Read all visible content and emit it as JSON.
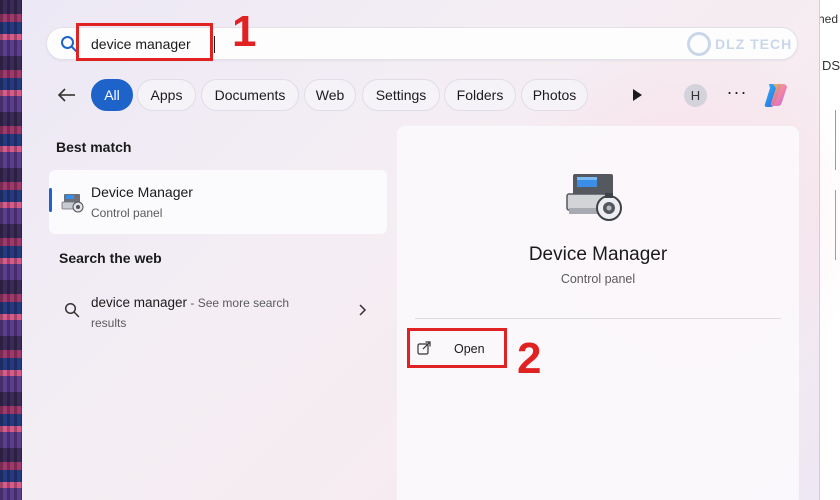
{
  "search": {
    "query": "device manager"
  },
  "watermark": {
    "text": "DLZ TECH"
  },
  "annotations": {
    "step1": "1",
    "step2": "2"
  },
  "filters": {
    "chips": [
      "All",
      "Apps",
      "Documents",
      "Web",
      "Settings",
      "Folders",
      "Photos"
    ],
    "active": "All",
    "avatar_initial": "H",
    "more_label": "···"
  },
  "best_match": {
    "heading": "Best match",
    "title": "Device Manager",
    "subtitle": "Control panel"
  },
  "web_search": {
    "heading": "Search the web",
    "query": "device manager",
    "suffix": " - See more search",
    "suffix2": "results"
  },
  "detail": {
    "title": "Device Manager",
    "subtitle": "Control panel",
    "open_label": "Open"
  },
  "background": {
    "right_text_top": "hed",
    "right_text_mid": "DS"
  },
  "colors": {
    "accent": "#1d63c9",
    "annotation": "#e02222"
  },
  "icons": {
    "search": "search-icon",
    "back": "back-arrow-icon",
    "play": "play-icon",
    "more": "more-icon",
    "copilot": "copilot-icon",
    "device_manager": "device-manager-icon",
    "open": "open-external-icon",
    "chevron": "chevron-right-icon"
  }
}
